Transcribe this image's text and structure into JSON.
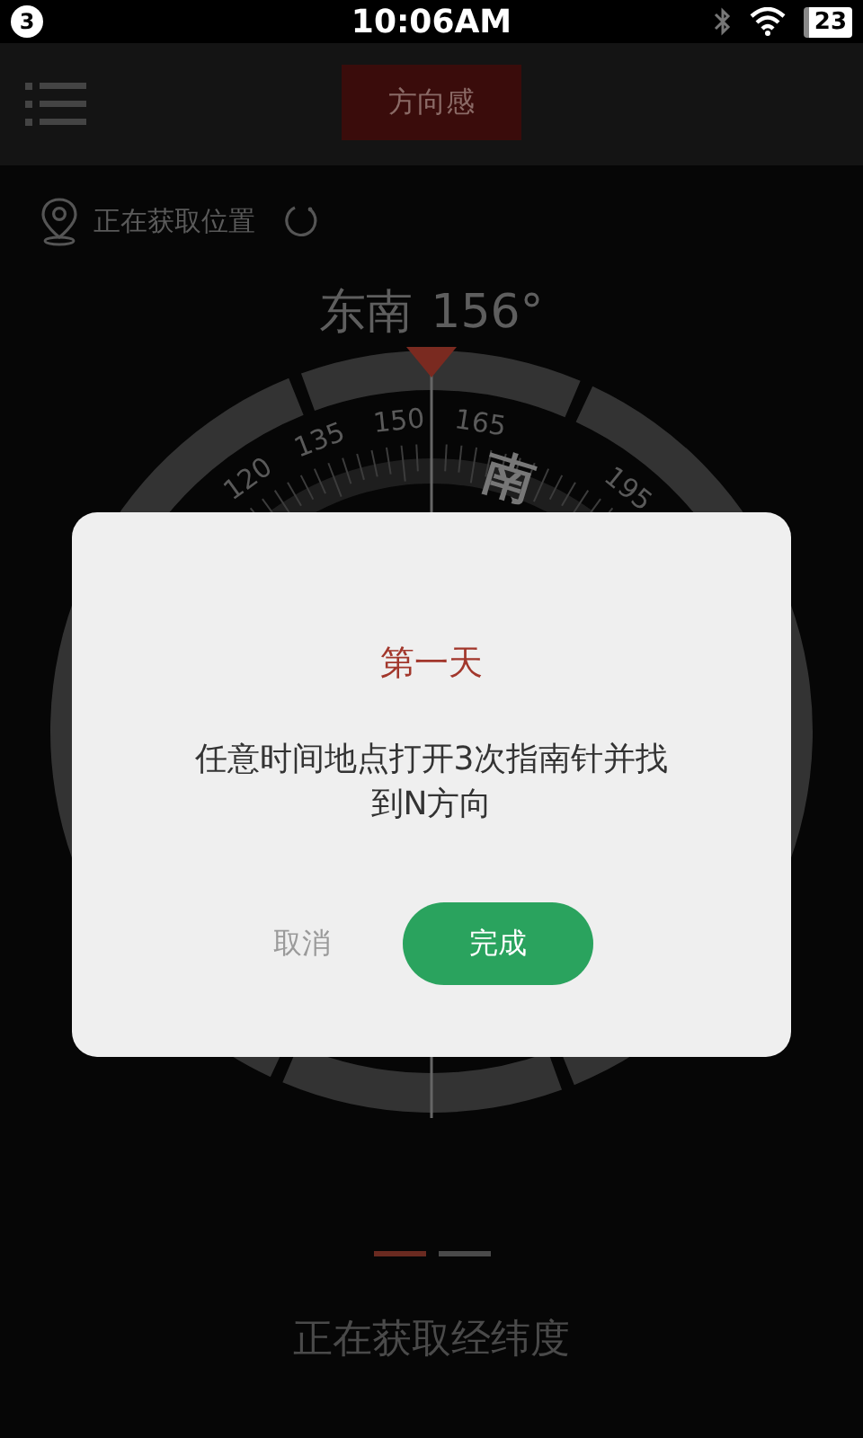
{
  "status_bar": {
    "notification_count": "3",
    "time": "10:06AM",
    "battery": "23"
  },
  "header": {
    "title_button": "方向感"
  },
  "location": {
    "text": "正在获取位置"
  },
  "heading": {
    "direction": "东南",
    "degrees": "156°"
  },
  "compass": {
    "scale_labels": [
      "120",
      "135",
      "150",
      "165",
      "195"
    ],
    "direction_letter": "南"
  },
  "page_indicators": [
    {
      "selected": true
    },
    {
      "selected": false
    }
  ],
  "status_text": "正在获取经纬度",
  "dialog": {
    "title": "第一天",
    "message": "任意时间地点打开3次指南针并找到N方向",
    "buttons": [
      {
        "label": "取消",
        "kind": "text"
      },
      {
        "label": "完成",
        "kind": "primary"
      }
    ]
  }
}
